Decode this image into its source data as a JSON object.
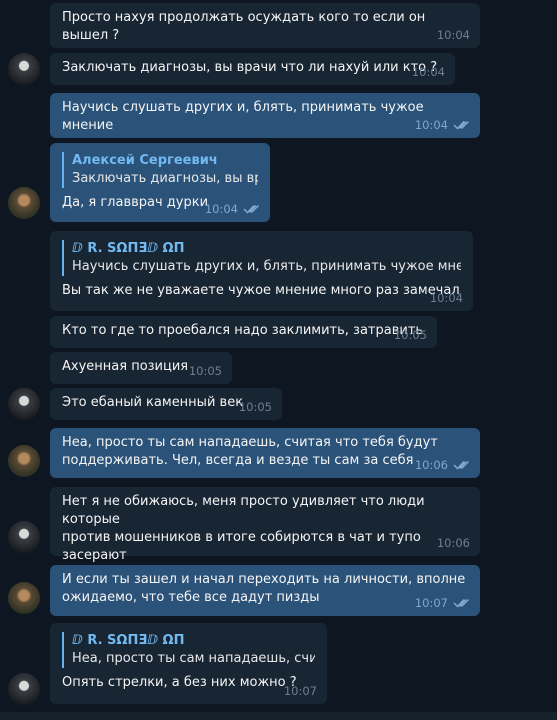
{
  "messages": [
    {
      "text": "Просто нахуя продолжать осуждать кого то если он вышел ?",
      "time": "10:04"
    },
    {
      "text": "Заключать диагнозы, вы врачи что ли нахуй или кто ?",
      "time": "10:04"
    },
    {
      "text": "Научись слушать других и, блять, принимать чужое мнение",
      "time": "10:04"
    },
    {
      "reply_name": "Алексей Сергеевич",
      "reply_text": "Заключать диагнозы, вы вр...",
      "text": "Да, я главврач дурки",
      "time": "10:04"
    },
    {
      "reply_name": "ⅅ R. SΩΠƎⅅ ΩΠ",
      "reply_text": "Научись слушать других и, блять, принимать чужое мнение",
      "text": "Вы так же не уважаете чужое мнение много раз замечал",
      "time": "10:04"
    },
    {
      "text": "Кто то где то проебался надо заклимить, затравить",
      "time": "10:05"
    },
    {
      "text": "Ахуенная позиция",
      "time": "10:05"
    },
    {
      "text": "Это ебаный каменный век",
      "time": "10:05"
    },
    {
      "text": "Неа, просто ты сам нападаешь, считая что тебя будут\nподдерживать. Чел, всегда и везде ты сам за себя",
      "time": "10:06"
    },
    {
      "text": "Нет я не обижаюсь, меня просто удивляет что люди которые\nпротив мошенников в  итоге собирются в чат и тупо засерают\nтого кто сходится с их же мнением",
      "time": "10:06"
    },
    {
      "text": "И если ты зашел и начал переходить на личности, вполне\nожидаемо, что тебе все дадут пизды",
      "time": "10:07"
    },
    {
      "reply_name": "ⅅ R. SΩΠƎⅅ ΩΠ",
      "reply_text": "Неа, просто ты сам нападаешь, счит...",
      "text": "Опять стрелки, а без них можно ?",
      "time": "10:07"
    }
  ]
}
